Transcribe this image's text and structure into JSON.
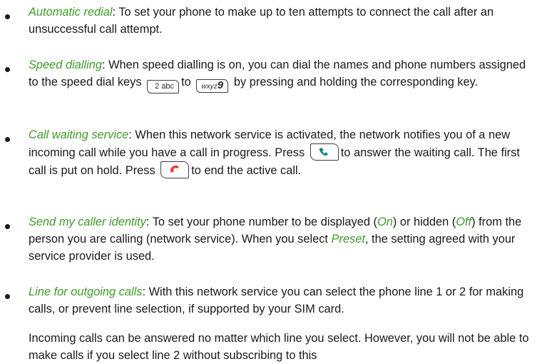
{
  "items": [
    {
      "term": "Automatic redial",
      "text": ": To set your phone to make up to ten attempts to connect the call after an unsuccessful call attempt."
    },
    {
      "term": "Speed dialling",
      "text_before": ": When speed dialling is on, you can dial the names and phone numbers assigned to the speed dial keys",
      "text_mid": "to",
      "text_after": "by pressing and holding the corresponding key.",
      "key_start": "2 abc",
      "key_end_letters": "wxyz",
      "key_end_digit": "9"
    },
    {
      "term": "Call waiting service",
      "text_before": ": When this network service is activated, the network notifies you of a new incoming call while you have a call in progress. Press",
      "text_mid": "to answer the waiting call. The first call is put on hold. Press",
      "text_after": "to end the active call."
    },
    {
      "term": "Send my caller identity",
      "text_a": ": To set your phone number to be displayed (",
      "opt_on": "On",
      "text_b": ") or hidden (",
      "opt_off": "Off",
      "text_c": ") from the person you are calling (network service). When you select",
      "opt_preset": "Preset",
      "text_d": ", the setting agreed with your service provider is used."
    },
    {
      "term": "Line for outgoing calls",
      "text": ": With this network service you can select the phone line 1 or 2 for making calls, or prevent line selection, if supported by your SIM card.",
      "note": "Incoming calls can be answered no matter which line you select. However, you will not be able to make calls if you select line 2 without subscribing to this"
    }
  ],
  "colors": {
    "term": "#3f9a2a",
    "call_green": "#1f8a7a",
    "end_red": "#e0463c"
  },
  "icons": [
    "call-key-icon",
    "end-key-icon"
  ]
}
